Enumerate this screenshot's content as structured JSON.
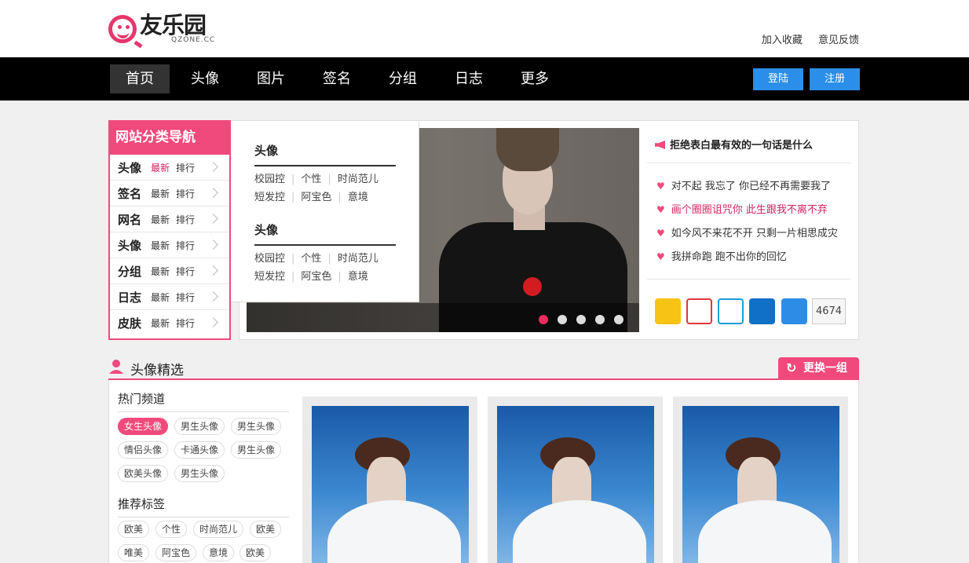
{
  "logo": {
    "cn": "友乐园",
    "en": "QZONE.CC"
  },
  "toplinks": [
    "加入收藏",
    "意见反馈"
  ],
  "nav": {
    "items": [
      "首页",
      "头像",
      "图片",
      "签名",
      "分组",
      "日志",
      "更多"
    ],
    "active_index": 0,
    "login": "登陆",
    "register": "注册",
    "button_color": "#2b8ee8"
  },
  "category_nav": {
    "title": "网站分类导航",
    "rows": [
      {
        "name": "头像",
        "latest": "最新",
        "rank": "排行",
        "highlight": true
      },
      {
        "name": "签名",
        "latest": "最新",
        "rank": "排行"
      },
      {
        "name": "网名",
        "latest": "最新",
        "rank": "排行"
      },
      {
        "name": "头像",
        "latest": "最新",
        "rank": "排行"
      },
      {
        "name": "分组",
        "latest": "最新",
        "rank": "排行"
      },
      {
        "name": "日志",
        "latest": "最新",
        "rank": "排行"
      },
      {
        "name": "皮肤",
        "latest": "最新",
        "rank": "排行"
      }
    ]
  },
  "flyout": {
    "groups": [
      {
        "title": "头像",
        "line1": [
          "校园控",
          "个性",
          "时尚范儿"
        ],
        "line2": [
          "短发控",
          "阿宝色",
          "意境"
        ]
      },
      {
        "title": "头像",
        "line1": [
          "校园控",
          "个性",
          "时尚范儿"
        ],
        "line2": [
          "短发控",
          "阿宝色",
          "意境"
        ]
      }
    ]
  },
  "slider": {
    "dots": 5,
    "active_dot": 0
  },
  "quotes": {
    "title": "拒绝表白最有效的一句话是什么",
    "items": [
      {
        "text": "对不起 我忘了 你已经不再需要我了"
      },
      {
        "text": "画个圈圈诅咒你 此生跟我不离不弃",
        "highlight": true
      },
      {
        "text": "如今风不来花不开 只剩一片相思成灾"
      },
      {
        "text": "我拼命跑 跑不出你的回忆"
      }
    ]
  },
  "share": {
    "icons": [
      "qzone-icon",
      "weibo-icon",
      "tencent-weibo-icon",
      "renren-icon",
      "more-share-icon"
    ],
    "count": "4674"
  },
  "avatar_section": {
    "title": "头像精选",
    "refresh": "更换一组",
    "hot_title": "热门频道",
    "hot_tags": [
      "女生头像",
      "男生头像",
      "男生头像",
      "情侣头像",
      "卡通头像",
      "男生头像",
      "欧美头像",
      "男生头像"
    ],
    "rec_title": "推荐标签",
    "rec_tags": [
      "欧美",
      "个性",
      "时尚范儿",
      "欧美",
      "唯美",
      "阿宝色",
      "意境",
      "欧美"
    ]
  },
  "colors": {
    "accent": "#f04a7c",
    "nav_bg": "#000000"
  }
}
